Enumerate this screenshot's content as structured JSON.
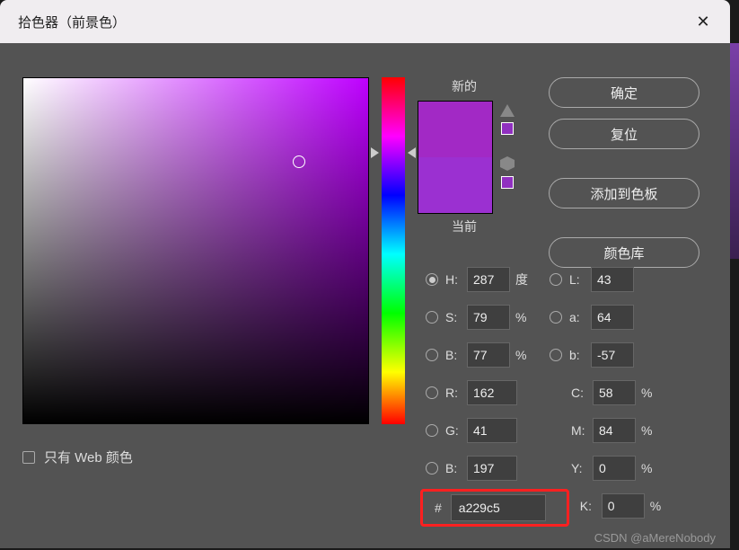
{
  "dialog": {
    "title": "拾色器（前景色）"
  },
  "buttons": {
    "ok": "确定",
    "reset": "复位",
    "add_swatch": "添加到色板",
    "libraries": "颜色库"
  },
  "preview": {
    "new_label": "新的",
    "current_label": "当前"
  },
  "web_only": {
    "label": "只有 Web 颜色"
  },
  "hsb": {
    "h_label": "H:",
    "h_value": "287",
    "h_unit": "度",
    "s_label": "S:",
    "s_value": "79",
    "s_unit": "%",
    "b_label": "B:",
    "b_value": "77",
    "b_unit": "%"
  },
  "lab": {
    "l_label": "L:",
    "l_value": "43",
    "a_label": "a:",
    "a_value": "64",
    "b_label": "b:",
    "b_value": "-57"
  },
  "rgb": {
    "r_label": "R:",
    "r_value": "162",
    "g_label": "G:",
    "g_value": "41",
    "b_label": "B:",
    "b_value": "197"
  },
  "cmyk": {
    "c_label": "C:",
    "c_value": "58",
    "c_unit": "%",
    "m_label": "M:",
    "m_value": "84",
    "m_unit": "%",
    "y_label": "Y:",
    "y_value": "0",
    "y_unit": "%",
    "k_label": "K:",
    "k_value": "0",
    "k_unit": "%"
  },
  "hex": {
    "hash": "#",
    "value": "a229c5"
  },
  "watermark": "CSDN @aMereNobody"
}
